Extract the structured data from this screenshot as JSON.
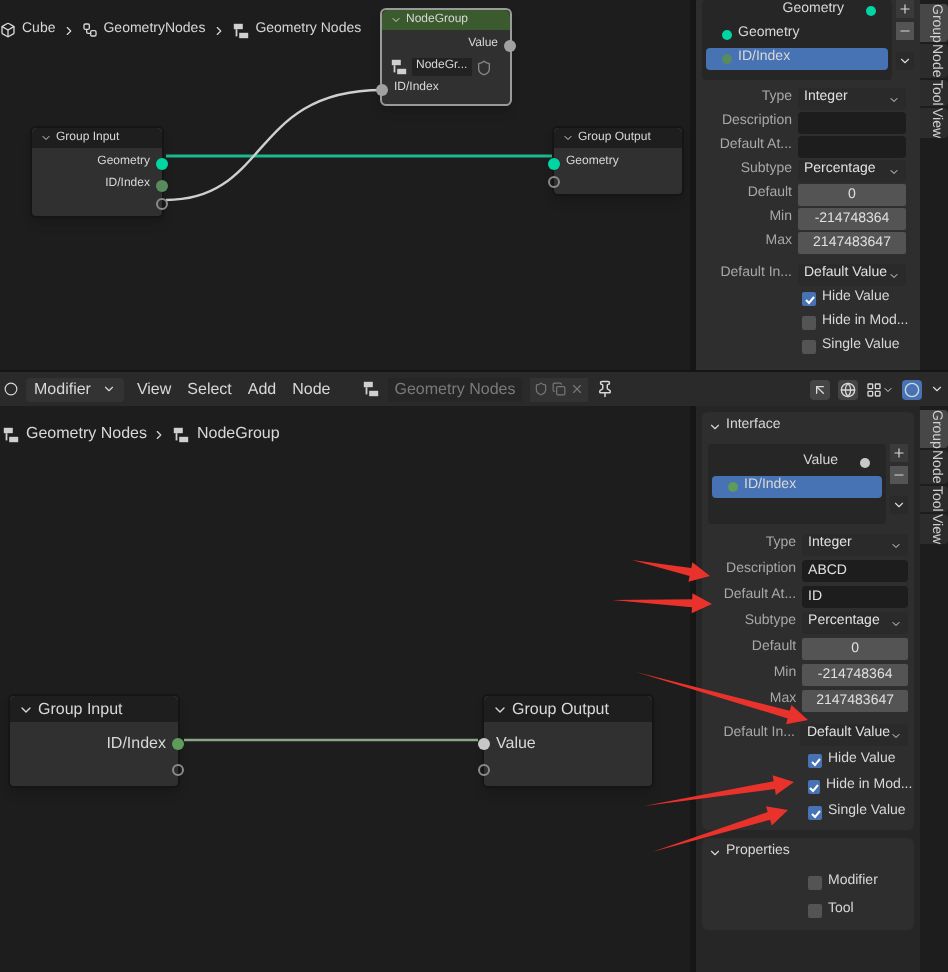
{
  "top": {
    "breadcrumb": [
      "Cube",
      "GeometryNodes",
      "Geometry Nodes"
    ],
    "nodes": [
      {
        "kind": "group_node",
        "title": "NodeGroup",
        "outputs": [
          {
            "label": "Value",
            "color": "#a1a1a1"
          }
        ],
        "selector": "NodeGr...",
        "inputs": [
          {
            "label": "ID/Index",
            "color": "#a1a1a1"
          }
        ]
      },
      {
        "kind": "group_input",
        "title": "Group Input",
        "sockets": [
          {
            "label": "Geometry",
            "color": "#00d6a3"
          },
          {
            "label": "ID/Index",
            "color": "#598c5c"
          }
        ]
      },
      {
        "kind": "group_output",
        "title": "Group Output",
        "sockets": [
          {
            "label": "Geometry",
            "color": "#00d6a3"
          }
        ]
      }
    ],
    "sidebar": {
      "sockets": [
        {
          "label": "Geometry",
          "kind": "output",
          "color": "#00d6a3",
          "selected": false
        },
        {
          "label": "Geometry",
          "kind": "input",
          "color": "#00d6a3",
          "selected": false
        },
        {
          "label": "ID/Index",
          "kind": "input",
          "color": "#598c5c",
          "selected": true
        }
      ],
      "rows": [
        {
          "kind": "dropdown",
          "label": "Type",
          "value": "Integer"
        },
        {
          "kind": "text",
          "label": "Description"
        },
        {
          "kind": "text",
          "label": "Default At..."
        },
        {
          "kind": "dropdown",
          "label": "Subtype",
          "value": "Percentage"
        },
        {
          "kind": "number",
          "label": "Default",
          "value": "0"
        },
        {
          "kind": "number",
          "label": "Min",
          "value": "-214748364"
        },
        {
          "kind": "number",
          "label": "Max",
          "value": "2147483647"
        },
        {
          "kind": "dropdown",
          "label": "Default In...",
          "value": "Default Value"
        },
        {
          "kind": "checkbox",
          "label": "Hide Value",
          "checked": true
        },
        {
          "kind": "checkbox",
          "label": "Hide in Mod...",
          "checked": false
        },
        {
          "kind": "checkbox",
          "label": "Single Value",
          "checked": false
        }
      ],
      "tabs": [
        {
          "label": "Group",
          "selected": true
        },
        {
          "label": "Node",
          "selected": false
        },
        {
          "label": "Tool",
          "selected": false
        },
        {
          "label": "View",
          "selected": false
        }
      ]
    }
  },
  "bottom": {
    "header": {
      "editor": "Modifier",
      "menus": [
        "View",
        "Select",
        "Add",
        "Node"
      ],
      "tree": "Geometry Nodes"
    },
    "breadcrumb": [
      "Geometry Nodes",
      "NodeGroup"
    ],
    "nodes": [
      {
        "kind": "group_input",
        "title": "Group Input",
        "sockets": [
          {
            "label": "ID/Index",
            "color": "#5f9b5a"
          }
        ]
      },
      {
        "kind": "group_output",
        "title": "Group Output",
        "sockets": [
          {
            "label": "Value",
            "color": "#c8c8c8"
          }
        ]
      }
    ],
    "sidebar": {
      "section": "Interface",
      "sockets": [
        {
          "label": "Value",
          "kind": "output",
          "color": "#c8c8c8",
          "selected": false
        },
        {
          "label": "ID/Index",
          "kind": "input",
          "color": "#5f9b5a",
          "selected": true
        }
      ],
      "rows": [
        {
          "kind": "dropdown",
          "label": "Type",
          "value": "Integer"
        },
        {
          "kind": "text",
          "label": "Description",
          "value": "ABCD"
        },
        {
          "kind": "text",
          "label": "Default At...",
          "value": "ID"
        },
        {
          "kind": "dropdown",
          "label": "Subtype",
          "value": "Percentage"
        },
        {
          "kind": "number",
          "label": "Default",
          "value": "0"
        },
        {
          "kind": "number",
          "label": "Min",
          "value": "-214748364"
        },
        {
          "kind": "number",
          "label": "Max",
          "value": "2147483647"
        },
        {
          "kind": "dropdown",
          "label": "Default In...",
          "value": "Default Value"
        },
        {
          "kind": "checkbox",
          "label": "Hide Value",
          "checked": true
        },
        {
          "kind": "checkbox",
          "label": "Hide in Mod...",
          "checked": true
        },
        {
          "kind": "checkbox",
          "label": "Single Value",
          "checked": true
        }
      ],
      "properties": {
        "title": "Properties",
        "options": [
          {
            "label": "Modifier",
            "checked": false
          },
          {
            "label": "Tool",
            "checked": false
          }
        ]
      },
      "tabs": [
        {
          "label": "Group",
          "selected": true
        },
        {
          "label": "Node",
          "selected": false
        },
        {
          "label": "Tool",
          "selected": false
        },
        {
          "label": "View",
          "selected": false
        }
      ]
    }
  }
}
